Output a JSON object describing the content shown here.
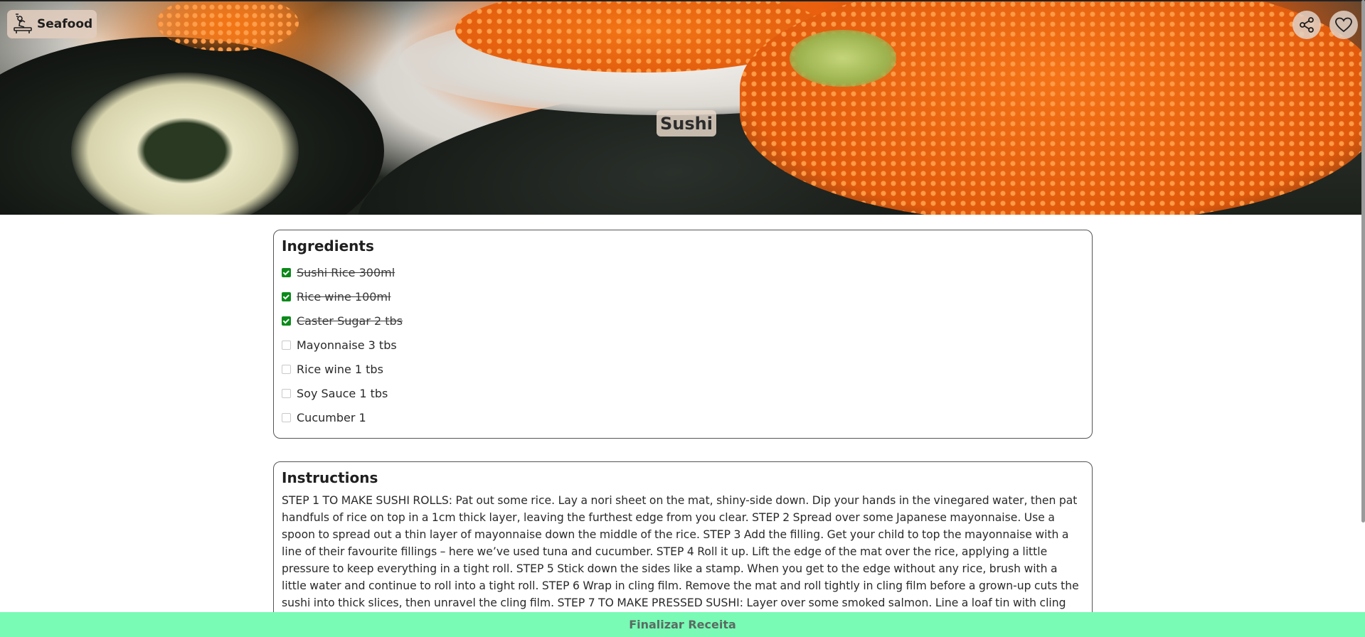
{
  "header": {
    "category": "Seafood",
    "category_icon": "chef-icon",
    "share_icon": "share-icon",
    "favorite_icon": "heart-icon"
  },
  "recipe": {
    "title": "Sushi"
  },
  "ingredients": {
    "heading": "Ingredients",
    "items": [
      {
        "label": "Sushi Rice 300ml",
        "checked": true
      },
      {
        "label": "Rice wine 100ml",
        "checked": true
      },
      {
        "label": "Caster Sugar 2 tbs",
        "checked": true
      },
      {
        "label": "Mayonnaise 3 tbs",
        "checked": false
      },
      {
        "label": "Rice wine 1 tbs",
        "checked": false
      },
      {
        "label": "Soy Sauce 1 tbs",
        "checked": false
      },
      {
        "label": "Cucumber 1",
        "checked": false
      }
    ]
  },
  "instructions": {
    "heading": "Instructions",
    "text": "STEP 1 TO MAKE SUSHI ROLLS: Pat out some rice. Lay a nori sheet on the mat, shiny-side down. Dip your hands in the vinegared water, then pat handfuls of rice on top in a 1cm thick layer, leaving the furthest edge from you clear.  STEP 2 Spread over some Japanese mayonnaise. Use a spoon to spread out a thin layer of mayonnaise down the middle of the rice.  STEP 3 Add the filling. Get your child to top the mayonnaise with a line of their favourite fillings – here we’ve used tuna and cucumber.  STEP 4 Roll it up. Lift the edge of the mat over the rice, applying a little pressure to keep everything in a tight roll.  STEP 5 Stick down the sides like a stamp. When you get to the edge without any rice, brush with a little water and continue to roll into a tight roll.  STEP 6 Wrap in cling film. Remove the mat and roll tightly in cling film before a grown-up cuts the sushi into thick slices, then unravel the cling film.  STEP 7 TO MAKE PRESSED SUSHI: Layer over some smoked salmon. Line a loaf tin with cling"
  },
  "footer": {
    "finish_label": "Finalizar Receita"
  },
  "colors": {
    "finish_bar": "#79fab5",
    "checkbox_checked": "#0b8a1a"
  }
}
